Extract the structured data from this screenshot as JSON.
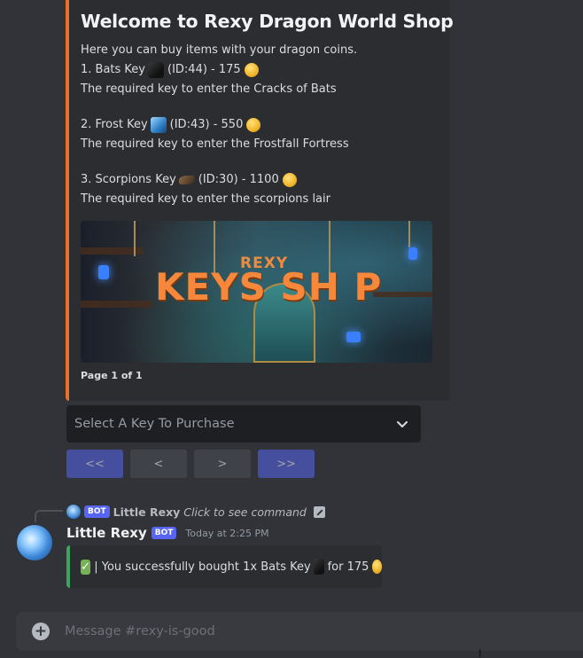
{
  "embed": {
    "title": "Welcome to Rexy Dragon World Shop",
    "intro": "Here you can buy items with your dragon coins.",
    "items": [
      {
        "line1_prefix": "1. Bats Key",
        "line1_suffix": "(ID:44) - 175",
        "desc": "The required key to enter the Cracks of Bats",
        "key_icon": "bats-key-icon"
      },
      {
        "line1_prefix": "2. Frost Key",
        "line1_suffix": "(ID:43) - 550",
        "desc": "The required key to enter the Frostfall Fortress",
        "key_icon": "frost-key-icon"
      },
      {
        "line1_prefix": "3. Scorpions Key",
        "line1_suffix": "(ID:30) - 1100",
        "desc": "The required key to enter the scorpions lair",
        "key_icon": "scorpions-key-icon"
      }
    ],
    "banner_small": "REXY",
    "banner_title": "KEYS SH P",
    "footer": "Page 1 of 1",
    "accent_color": "#e8702a"
  },
  "select": {
    "placeholder": "Select A Key To Purchase"
  },
  "pager": {
    "first": "<<",
    "prev": "<",
    "next": ">",
    "last": ">>"
  },
  "reply": {
    "bot_tag": "BOT",
    "name": "Little Rexy",
    "command_text": "Click to see command"
  },
  "message": {
    "author": "Little Rexy",
    "bot_tag": "BOT",
    "timestamp": "Today at 2:25 PM",
    "text_prefix": "| You successfully bought 1x Bats Key",
    "text_suffix": "for 175",
    "accent_color": "#3ba55c"
  },
  "composer": {
    "placeholder": "Message #rexy-is-good"
  }
}
